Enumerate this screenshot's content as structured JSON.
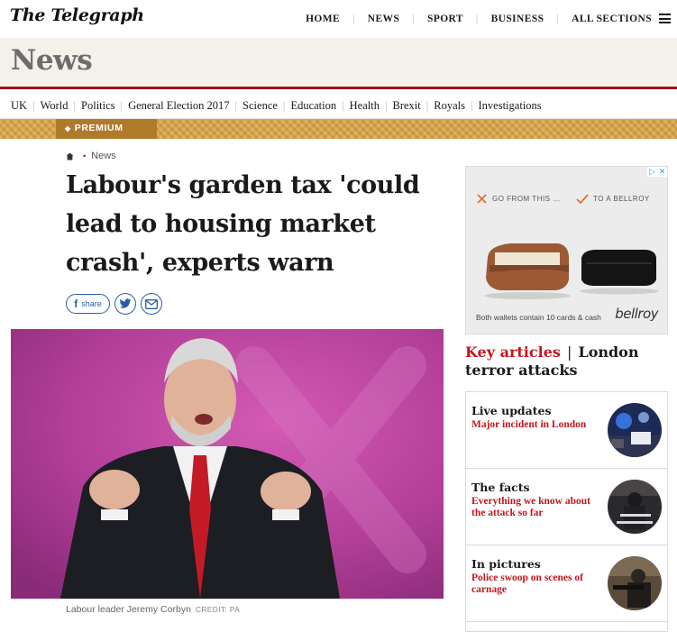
{
  "brand": {
    "logo_text": "The Telegraph"
  },
  "topnav": [
    "HOME",
    "NEWS",
    "SPORT",
    "BUSINESS",
    "ALL SECTIONS"
  ],
  "section": {
    "title": "News"
  },
  "subnav": [
    "UK",
    "World",
    "Politics",
    "General Election 2017",
    "Science",
    "Education",
    "Health",
    "Brexit",
    "Royals",
    "Investigations"
  ],
  "premium": {
    "label": "PREMIUM"
  },
  "breadcrumb": {
    "current": "News"
  },
  "article": {
    "headline": "Labour's garden tax 'could lead to housing market crash', experts warn",
    "share_label": "share",
    "caption": "Labour leader Jeremy Corbyn",
    "credit": "CREDIT: PA"
  },
  "ad": {
    "from_text": "GO FROM THIS ...",
    "to_text": "TO A BELLROY",
    "footer": "Both wallets contain 10 cards & cash",
    "brand": "bellroy"
  },
  "key_articles": {
    "label": "Key articles",
    "topic": "London terror attacks",
    "items": [
      {
        "title": "Live updates",
        "subtitle": "Major incident in London"
      },
      {
        "title": "The facts",
        "subtitle": "Everything we know about the attack so far"
      },
      {
        "title": "In pictures",
        "subtitle": "Police swoop on scenes of carnage"
      }
    ]
  },
  "colors": {
    "accent_red": "#c3161d",
    "rule_red": "#a1121c",
    "premium_gold": "#d6a244",
    "section_band": "#f4f1ea"
  }
}
